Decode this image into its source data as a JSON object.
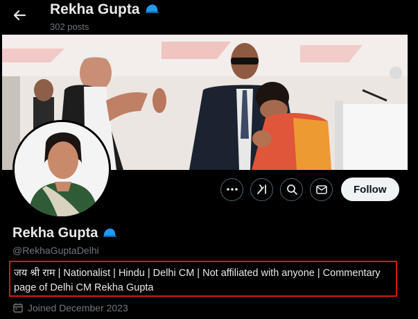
{
  "header": {
    "back_icon": "arrow-left-icon",
    "title": "Rekha Gupta",
    "badge_icon": "blue-cap-icon",
    "posts": "302 posts"
  },
  "banner": {
    "description_icon": "banner-photo"
  },
  "avatar": {
    "icon": "profile-photo"
  },
  "actions": {
    "more_icon": "more-icon",
    "grok_icon": "grok-icon",
    "search_icon": "search-icon",
    "message_icon": "mail-icon",
    "follow_label": "Follow"
  },
  "profile": {
    "name": "Rekha Gupta",
    "handle": "@RekhaGuptaDelhi",
    "bio": "जय श्री राम | Nationalist | Hindu | Delhi CM | Not affiliated with anyone | Commentary page of Delhi CM Rekha Gupta",
    "joined": "Joined December 2023"
  },
  "colors": {
    "background": "#000000",
    "text": "#e7e9ea",
    "muted": "#71767b",
    "highlight_border": "#d11a1a",
    "cap": "#1d9bf0"
  }
}
